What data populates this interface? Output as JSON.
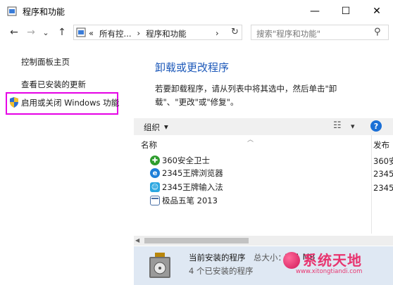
{
  "window": {
    "title": "程序和功能",
    "minimize_glyph": "—",
    "maximize_glyph": "☐",
    "close_glyph": "✕"
  },
  "nav": {
    "back_glyph": "←",
    "forward_glyph": "→",
    "dropdown_glyph": "⌄",
    "up_glyph": "↑",
    "breadcrumb": [
      "«",
      "所有控...",
      "›",
      "程序和功能",
      "›"
    ],
    "refresh_glyph": "↻",
    "search_placeholder": "搜索\"程序和功能\"",
    "search_glyph": "⚲"
  },
  "left_pane": {
    "home_link": "控制面板主页",
    "updates_link": "查看已安装的更新",
    "features_link": "启用或关闭 Windows 功能"
  },
  "main": {
    "title": "卸载或更改程序",
    "description": "若要卸载程序，请从列表中将其选中，然后单击\"卸载\"、\"更改\"或\"修复\"。",
    "organize_label": "组织",
    "organize_arrow": "▾",
    "view_glyph": "☷",
    "view_arrow": "▾",
    "help_glyph": "?",
    "columns": [
      "名称",
      "发布者"
    ],
    "col2_partial": "发布",
    "programs": [
      {
        "name": "360安全卫士",
        "publisher": "360安",
        "icon": "plus-shield-icon",
        "color": "#2e9d2e"
      },
      {
        "name": "2345王牌浏览器",
        "publisher": "2345",
        "icon": "browser-e-icon",
        "color": "#1e7fd8"
      },
      {
        "name": "2345王牌输入法",
        "publisher": "2345",
        "icon": "input-method-icon",
        "color": "#2aa6e0"
      },
      {
        "name": "极品五笔 2013",
        "publisher": "",
        "icon": "window-app-icon",
        "color": "#4a6fa5"
      }
    ]
  },
  "status": {
    "line1_label": "当前安装的程序",
    "size_label": "总大小：",
    "size_value": "191 MB",
    "line2": "4 个已安装的程序"
  },
  "watermark": {
    "brand": "系统天地",
    "url": "www.xitongtiandi.com"
  }
}
